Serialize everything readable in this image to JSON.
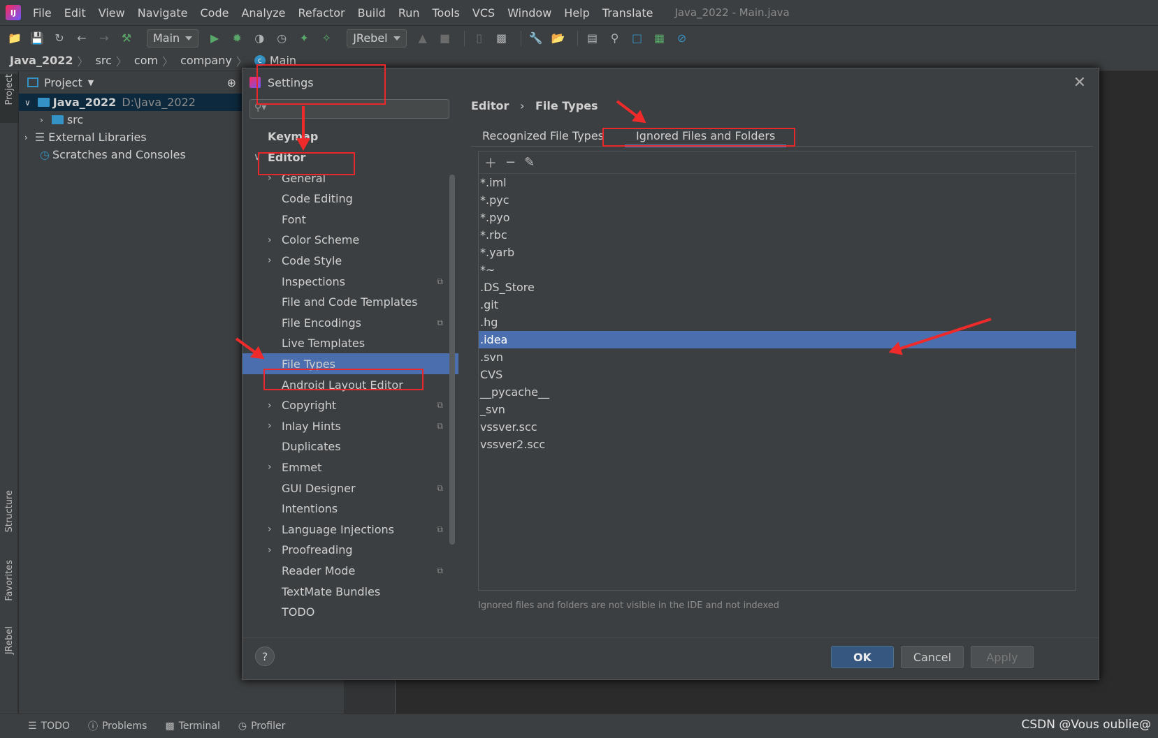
{
  "menubar": {
    "items": [
      "File",
      "Edit",
      "View",
      "Navigate",
      "Code",
      "Analyze",
      "Refactor",
      "Build",
      "Run",
      "Tools",
      "VCS",
      "Window",
      "Help",
      "Translate"
    ],
    "window_title": "Java_2022 - Main.java"
  },
  "toolbar": {
    "run_config": "Main",
    "jrebel_combo": "JRebel"
  },
  "navbar": {
    "crumbs": [
      "Java_2022",
      "src",
      "com",
      "company",
      "Main"
    ]
  },
  "project_panel": {
    "header": "Project",
    "rows": [
      {
        "label": "Java_2022",
        "path": "D:\\Java_2022"
      },
      {
        "label": "src"
      },
      {
        "label": "External Libraries"
      },
      {
        "label": "Scratches and Consoles"
      }
    ]
  },
  "left_strip": {
    "project": "Project",
    "structure": "Structure",
    "favorites": "Favorites",
    "jrebel": "JRebel"
  },
  "statusbar": {
    "items": [
      "TODO",
      "Problems",
      "Terminal",
      "Profiler"
    ]
  },
  "watermark": "CSDN @Vous oublie@",
  "settings": {
    "title": "Settings",
    "search_placeholder": "",
    "sidebar": {
      "keymap": "Keymap",
      "editor": "Editor",
      "items": [
        {
          "label": "General",
          "expandable": true,
          "badge": false
        },
        {
          "label": "Code Editing",
          "expandable": false,
          "badge": false
        },
        {
          "label": "Font",
          "expandable": false,
          "badge": false
        },
        {
          "label": "Color Scheme",
          "expandable": true,
          "badge": false
        },
        {
          "label": "Code Style",
          "expandable": true,
          "badge": false
        },
        {
          "label": "Inspections",
          "expandable": false,
          "badge": true
        },
        {
          "label": "File and Code Templates",
          "expandable": false,
          "badge": false
        },
        {
          "label": "File Encodings",
          "expandable": false,
          "badge": true
        },
        {
          "label": "Live Templates",
          "expandable": false,
          "badge": false
        },
        {
          "label": "File Types",
          "expandable": false,
          "badge": false,
          "selected": true
        },
        {
          "label": "Android Layout Editor",
          "expandable": false,
          "badge": false
        },
        {
          "label": "Copyright",
          "expandable": true,
          "badge": true
        },
        {
          "label": "Inlay Hints",
          "expandable": true,
          "badge": true
        },
        {
          "label": "Duplicates",
          "expandable": false,
          "badge": false
        },
        {
          "label": "Emmet",
          "expandable": true,
          "badge": false
        },
        {
          "label": "GUI Designer",
          "expandable": false,
          "badge": true
        },
        {
          "label": "Intentions",
          "expandable": false,
          "badge": false
        },
        {
          "label": "Language Injections",
          "expandable": true,
          "badge": true
        },
        {
          "label": "Proofreading",
          "expandable": true,
          "badge": false
        },
        {
          "label": "Reader Mode",
          "expandable": false,
          "badge": true
        },
        {
          "label": "TextMate Bundles",
          "expandable": false,
          "badge": false
        },
        {
          "label": "TODO",
          "expandable": false,
          "badge": false
        }
      ]
    },
    "breadcrumb": [
      "Editor",
      "File Types"
    ],
    "tabs": [
      "Recognized File Types",
      "Ignored Files and Folders"
    ],
    "active_tab": "Ignored Files and Folders",
    "ignored_list": [
      "*.iml",
      "*.pyc",
      "*.pyo",
      "*.rbc",
      "*.yarb",
      "*~",
      ".DS_Store",
      ".git",
      ".hg",
      ".idea",
      ".svn",
      "CVS",
      "__pycache__",
      "_svn",
      "vssver.scc",
      "vssver2.scc"
    ],
    "selected_item": ".idea",
    "hint": "Ignored files and folders are not visible in the IDE and not indexed",
    "buttons": {
      "ok": "OK",
      "cancel": "Cancel",
      "apply": "Apply"
    },
    "help_label": "?"
  },
  "colors": {
    "selection": "#4b6eaf",
    "annotation": "#e8282b",
    "accent_tab": "#4a88c7"
  }
}
